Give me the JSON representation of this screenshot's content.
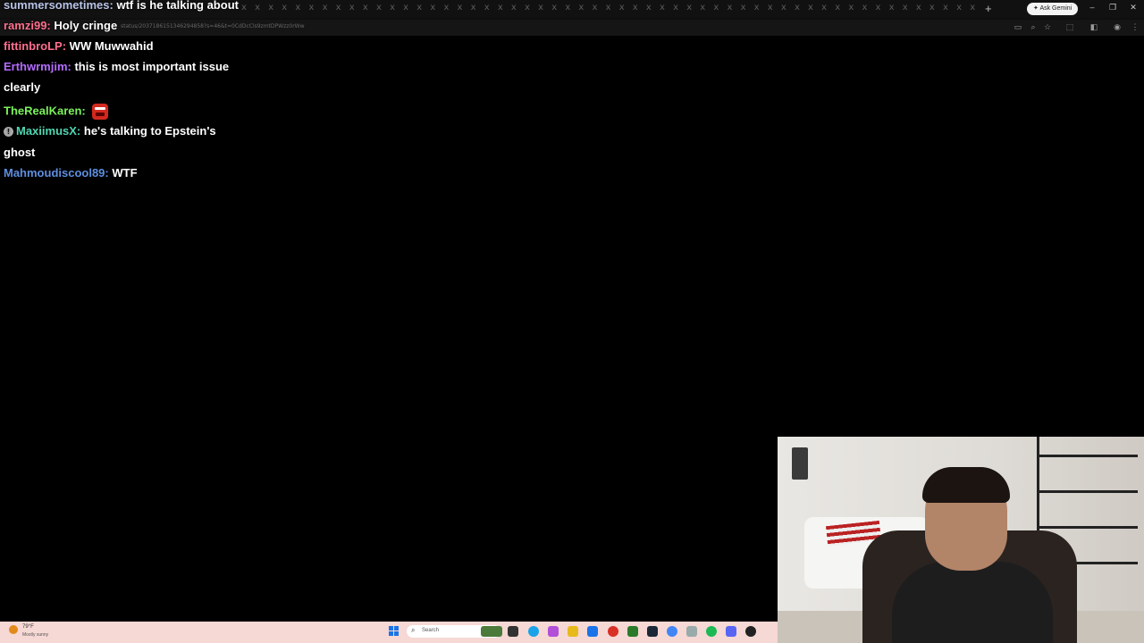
{
  "browser": {
    "tab_x_strip": "x x x x x x x x x x x x x x x x x x x x x x x x x x x x x x x x x x x x x x x x x x x x x x x x x x x x x x x x x x x x x x x x x x x x x x x x x x x x x x x x x x x x x x x x x x x x x x x x x x x x x x x x",
    "new_tab": "+",
    "ask_gemini": "Ask Gemini",
    "minimize": "–",
    "restore": "❐",
    "close": "✕",
    "url": "status/2037186151346294858?s=46&t=0CdDcCls9zmtDPWzz0rWw"
  },
  "chat": {
    "messages": [
      {
        "user": "summersometimes",
        "user_color": "#b9c4e8",
        "text": "wtf is he talking about"
      },
      {
        "user": "ramzi99",
        "user_color": "#ff6f8e",
        "text": "Holy cringe"
      },
      {
        "user": "fittinbroLP",
        "user_color": "#ff6f8e",
        "text": "WW Muwwahid"
      },
      {
        "user": "Erthwrmjim",
        "user_color": "#b46cff",
        "text": "this is most important issue"
      },
      {
        "user": "",
        "user_color": "#ffffff",
        "text": "clearly"
      },
      {
        "user": "TheRealKaren",
        "user_color": "#7cf25b",
        "text": "",
        "emote": "angry-face-emote"
      },
      {
        "user": "MaxiimusX",
        "user_color": "#4fd6b0",
        "text": "he's talking to Epstein's",
        "badge": "!"
      },
      {
        "user": "",
        "user_color": "#ffffff",
        "text": "ghost"
      },
      {
        "user": "Mahmoudiscool89",
        "user_color": "#5d8fe0",
        "text": "WTF"
      }
    ]
  },
  "taskbar": {
    "weather_temp": "79°F",
    "weather_desc": "Mostly sunny",
    "search_label": "Search",
    "search_icon": "search-icon"
  },
  "colors": {
    "taskbar_bg": "#f6d8d4",
    "background": "#000000"
  }
}
